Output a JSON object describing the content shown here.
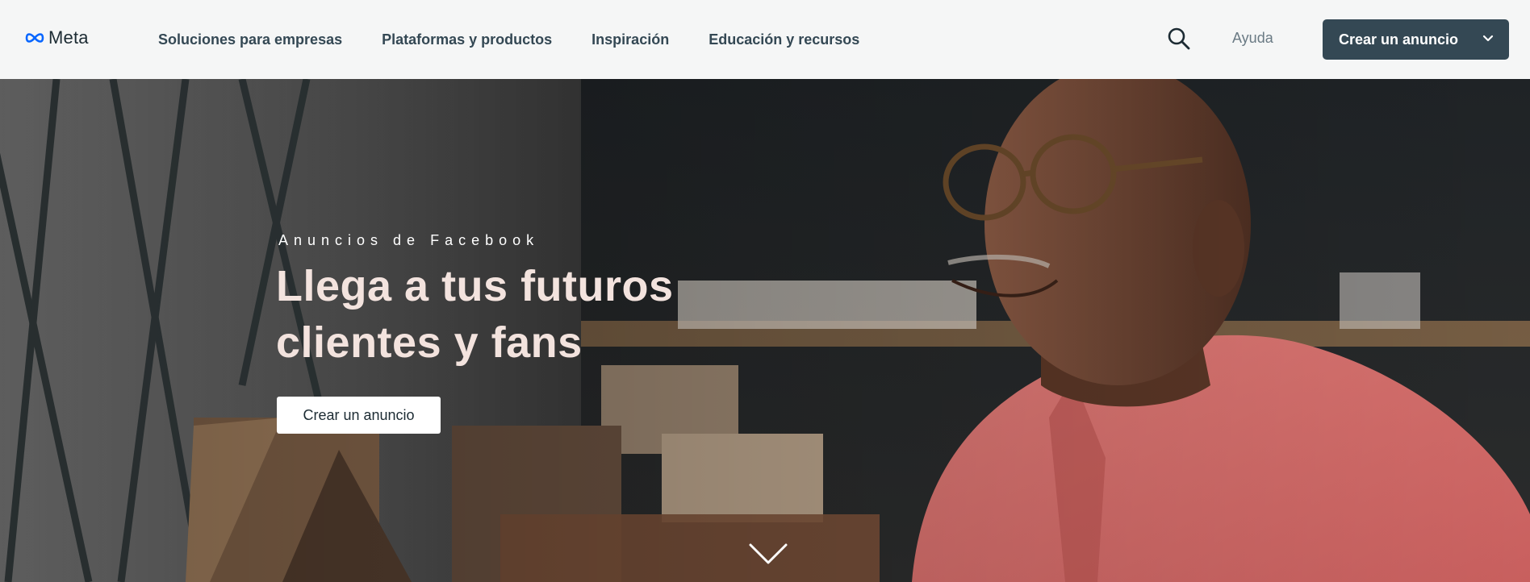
{
  "header": {
    "logo_text": "Meta",
    "nav": [
      {
        "label": "Soluciones para empresas"
      },
      {
        "label": "Plataformas y productos"
      },
      {
        "label": "Inspiración"
      },
      {
        "label": "Educación y recursos"
      }
    ],
    "search_icon": "search-icon",
    "help_label": "Ayuda",
    "cta_label": "Crear un anuncio",
    "cta_icon": "chevron-down-icon"
  },
  "hero": {
    "eyebrow": "Anuncios de Facebook",
    "headline": "Llega a tus futuros clientes y fans",
    "cta_label": "Crear un anuncio",
    "scroll_icon": "chevron-down-icon",
    "image": "man-smiling-by-window-photo"
  },
  "colors": {
    "header_bg": "#f5f6f6",
    "nav_text": "#344854",
    "primary_button": "#344854",
    "headline_text": "#f3e3de"
  }
}
